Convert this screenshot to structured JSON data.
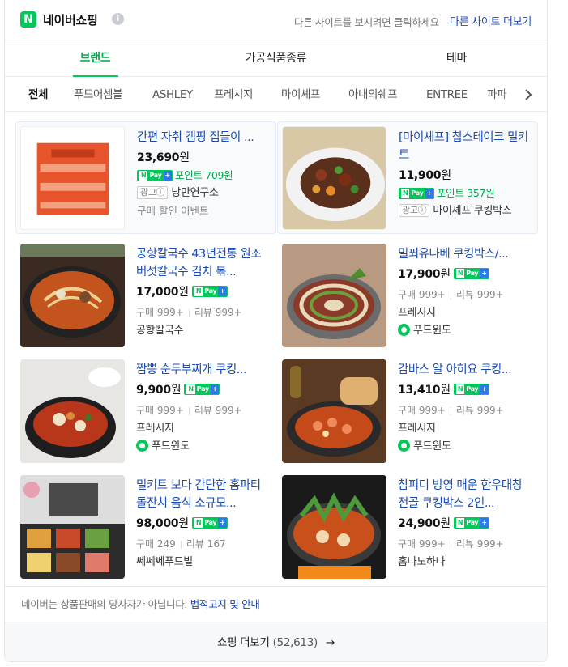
{
  "header": {
    "title": "네이버쇼핑",
    "logo_letter": "N",
    "info_glyph": "i",
    "description": "다른 사이트를 보시려면 클릭하세요",
    "more_sites": "다른 사이트 더보기"
  },
  "tabs": [
    {
      "label": "브랜드",
      "active": true
    },
    {
      "label": "가공식품종류",
      "active": false
    },
    {
      "label": "테마",
      "active": false
    }
  ],
  "chips": [
    "전체",
    "푸드어셈블",
    "ASHLEY",
    "프레시지",
    "마이셰프",
    "아내의쉐프",
    "ENTREE",
    "파파"
  ],
  "npay": {
    "n": "N",
    "pay": "Pay",
    "plus": "+"
  },
  "products": [
    {
      "title": "간편 자취 캠핑 집들이 ...",
      "price": "23,690",
      "unit": "원",
      "points": "포인트 709원",
      "ad": "광고ⓘ",
      "seller": "낭만연구소",
      "event": "구매 할인 이벤트"
    },
    {
      "title": "[마이셰프] 찹스테이크 밀키트",
      "price": "11,900",
      "unit": "원",
      "points": "포인트 357원",
      "ad": "광고ⓘ",
      "seller": "마이셰프 쿠킹박스"
    },
    {
      "title": "공항칼국수 43년전통 원조버섯칼국수 김치 볶...",
      "price": "17,000",
      "unit": "원",
      "purchase": "구매 999+",
      "review": "리뷰 999+",
      "seller": "공항칼국수"
    },
    {
      "title": "밀푀유나베 쿠킹박스/...",
      "price": "17,900",
      "unit": "원",
      "purchase": "구매 999+",
      "review": "리뷰 999+",
      "seller": "프레시지",
      "sub_seller": "푸드윈도"
    },
    {
      "title": "짬뽕 순두부찌개 쿠킹...",
      "price": "9,900",
      "unit": "원",
      "purchase": "구매 999+",
      "review": "리뷰 999+",
      "seller": "프레시지",
      "sub_seller": "푸드윈도"
    },
    {
      "title": "감바스 알 아히요 쿠킹...",
      "price": "13,410",
      "unit": "원",
      "purchase": "구매 999+",
      "review": "리뷰 999+",
      "seller": "프레시지",
      "sub_seller": "푸드윈도"
    },
    {
      "title": "밀키트 보다 간단한 홈파티 돌잔치 음식 소규모...",
      "price": "98,000",
      "unit": "원",
      "purchase": "구매 249",
      "review": "리뷰 167",
      "seller": "쎄쎄쎄푸드빌"
    },
    {
      "title": "참피디 방영 매운 한우대창전골 쿠킹박스 2인...",
      "price": "24,900",
      "unit": "원",
      "purchase": "구매 999+",
      "review": "리뷰 999+",
      "seller": "홈나노하나"
    }
  ],
  "footer": {
    "notice": "네이버는 상품판매의 당사자가 아닙니다.",
    "notice_link": "법적고지 및 안내",
    "more_label": "쇼핑 더보기",
    "more_count": "(52,613)",
    "more_arrow": "→"
  },
  "colors": {
    "brand_green": "#03c75a",
    "link_blue": "#1a4cb5"
  }
}
